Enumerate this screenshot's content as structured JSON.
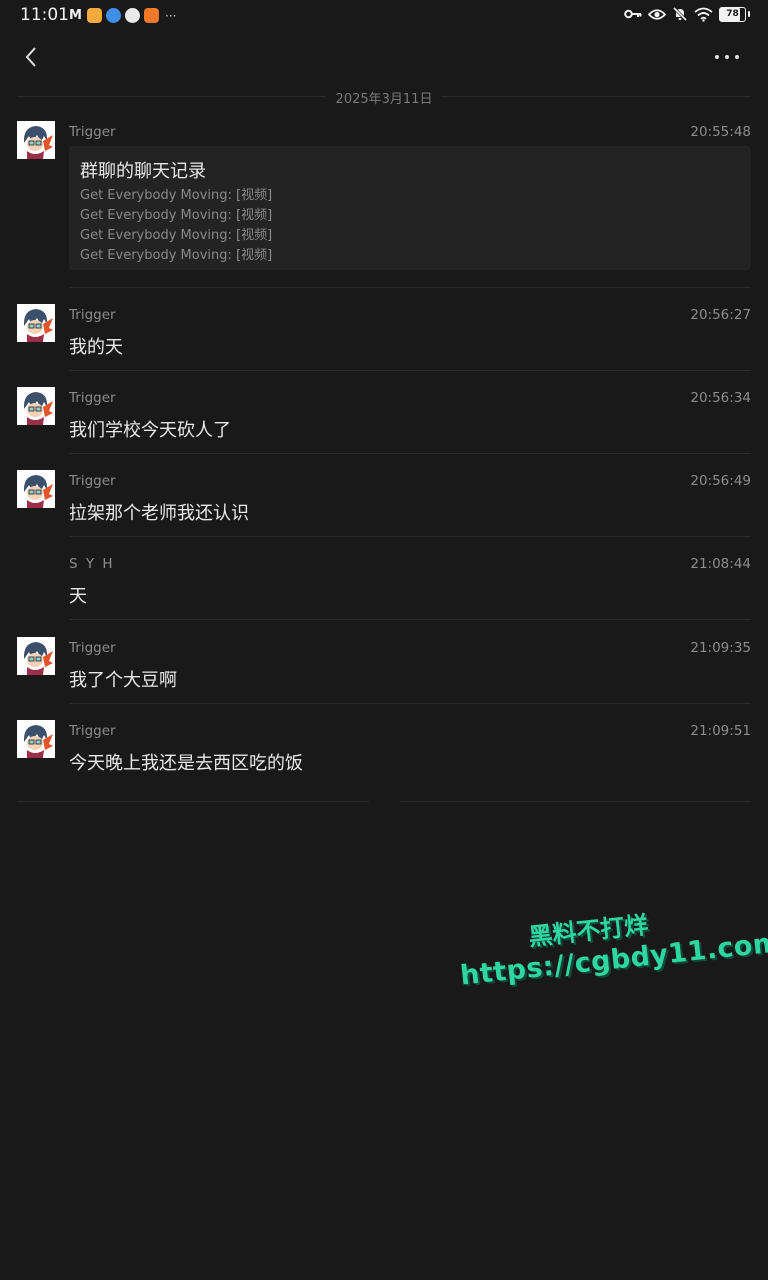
{
  "status_bar": {
    "time": "11:01",
    "mail_icon": "M",
    "more_indicator": "···",
    "battery": "78",
    "battery_level_percent": 78
  },
  "header": {
    "back_icon": "chevron-left-icon",
    "menu_icon": "more-dots-icon"
  },
  "date_divider": "2025年3月11日",
  "messages": [
    {
      "sender": "Trigger",
      "time": "20:55:48",
      "type": "chat-record",
      "record": {
        "title": "群聊的聊天记录",
        "lines": [
          "Get Everybody Moving: [视频]",
          "Get Everybody Moving: [视频]",
          "Get Everybody Moving: [视频]",
          "Get Everybody Moving: [视频]"
        ]
      }
    },
    {
      "sender": "Trigger",
      "time": "20:56:27",
      "text": "我的天"
    },
    {
      "sender": "Trigger",
      "time": "20:56:34",
      "text": "我们学校今天砍人了"
    },
    {
      "sender": "Trigger",
      "time": "20:56:49",
      "text": "拉架那个老师我还认识"
    },
    {
      "sender": "S Y H",
      "time": "21:08:44",
      "text": "天"
    },
    {
      "sender": "Trigger",
      "time": "21:09:35",
      "text": "我了个大豆啊"
    },
    {
      "sender": "Trigger",
      "time": "21:09:51",
      "text": "今天晚上我还是去西区吃的饭"
    }
  ],
  "watermark": {
    "line1": "黑料不打烊",
    "line2": "https://cgbdy11.com"
  },
  "colors": {
    "background": "#191919",
    "card": "#232323",
    "watermark": "#2fd6a0"
  }
}
